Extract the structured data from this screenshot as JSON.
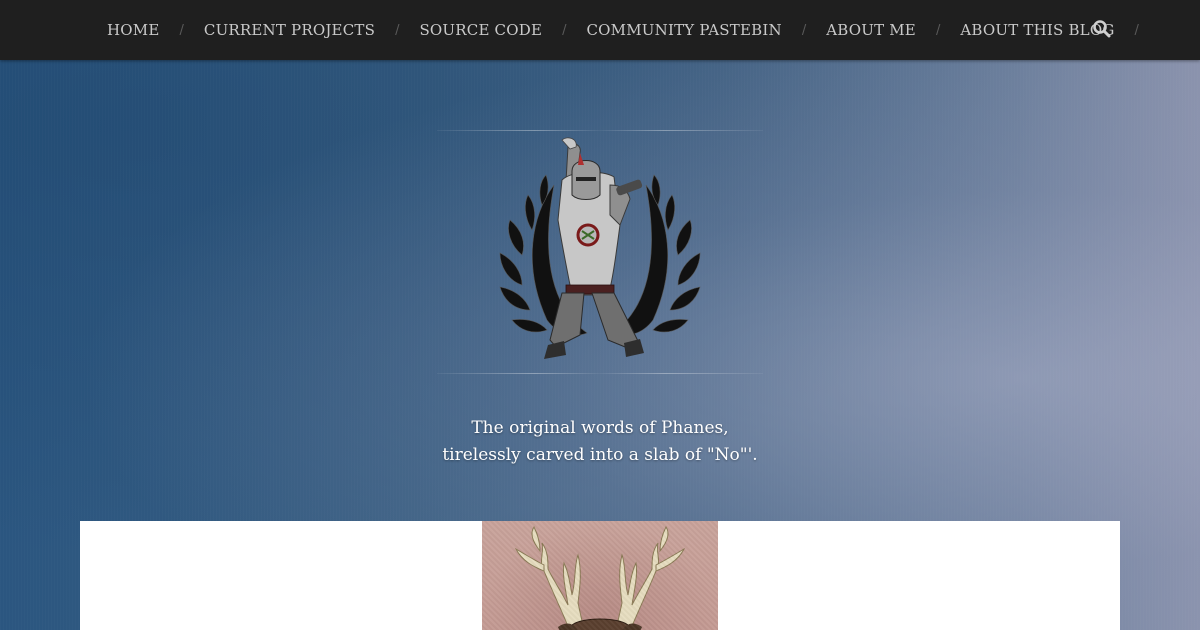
{
  "nav": {
    "items": [
      {
        "label": "HOME"
      },
      {
        "label": "CURRENT PROJECTS"
      },
      {
        "label": "SOURCE CODE"
      },
      {
        "label": "COMMUNITY PASTEBIN"
      },
      {
        "label": "ABOUT ME"
      },
      {
        "label": "ABOUT THIS BLOG"
      }
    ],
    "separator": "/",
    "search_icon": "search-icon"
  },
  "brand": {
    "logo_icon": "knight-laurel-logo",
    "tagline_line1": "The original words of Phanes,",
    "tagline_line2": "tirelessly carved into a slab of \"No\"'."
  },
  "post": {
    "thumbnail_icon": "deer-head-thumbnail"
  },
  "colors": {
    "nav_bg": "#1f1f1f",
    "nav_text": "#c9c9c9",
    "hero_blue": "#3a5f82",
    "card_bg": "#ffffff"
  }
}
